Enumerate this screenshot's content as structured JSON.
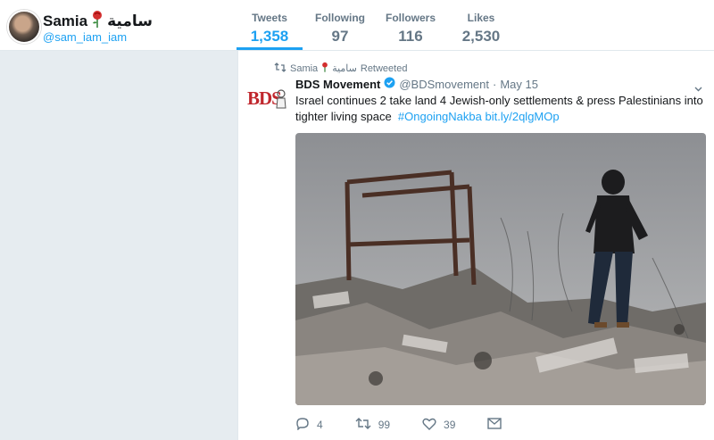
{
  "profile": {
    "name": "Samia",
    "name_arabic": "سامية",
    "handle": "@sam_iam_iam",
    "flower_icon": "rose-icon"
  },
  "stats": [
    {
      "label": "Tweets",
      "value": "1,358"
    },
    {
      "label": "Following",
      "value": "97"
    },
    {
      "label": "Followers",
      "value": "116"
    },
    {
      "label": "Likes",
      "value": "2,530"
    }
  ],
  "tweet": {
    "retweet_by_name": "Samia",
    "retweet_by_arabic": "سامية",
    "retweet_label": "Retweeted",
    "author_name": "BDS Movement",
    "author_handle": "@BDSmovement",
    "separator": "·",
    "date": "May 15",
    "logo_text": "BDS",
    "text_main": "Israel continues 2 take land 4 Jewish-only settlements & press Palestinians into tighter living space",
    "hashtag": "#OngoingNakba",
    "link": "bit.ly/2qlgMOp",
    "replies": "4",
    "retweets": "99",
    "likes": "39"
  },
  "colors": {
    "accent": "#1da1f2",
    "muted": "#657786",
    "logo_red": "#c0272d"
  }
}
